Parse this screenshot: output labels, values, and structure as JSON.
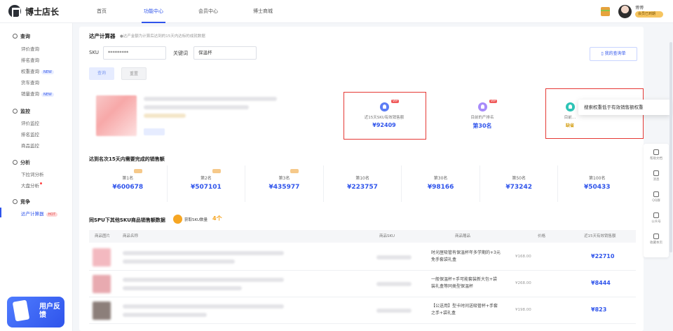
{
  "app": {
    "name": "博士店长"
  },
  "nav": [
    "首页",
    "功能中心",
    "会员中心",
    "博士商城"
  ],
  "user": {
    "name": "博博",
    "tag": "会员已到期"
  },
  "sidebar": {
    "groups": [
      {
        "title": "查询",
        "items": [
          {
            "label": "评价查询"
          },
          {
            "label": "排名查询"
          },
          {
            "label": "权重查询",
            "badge": "NEW"
          },
          {
            "label": "货车查询"
          },
          {
            "label": "销量查询",
            "badge": "NEW"
          }
        ]
      },
      {
        "title": "监控",
        "items": [
          {
            "label": "评价监控"
          },
          {
            "label": "排名监控"
          },
          {
            "label": "商品监控"
          }
        ]
      },
      {
        "title": "分析",
        "items": [
          {
            "label": "下拉词分析"
          },
          {
            "label": "大盘分析",
            "dot": true
          }
        ]
      },
      {
        "title": "竞争",
        "items": [
          {
            "label": "达产计算器",
            "badge": "HOT",
            "active": true
          }
        ]
      }
    ],
    "feedback": "用户反馈"
  },
  "page": {
    "title": "达产计算器",
    "tip": "●达产金额为计算后达到的15天内达标的成就数据"
  },
  "form": {
    "sku_label": "SKU",
    "sku_value": "*********",
    "keyword_label": "关键词",
    "keyword_value": "保温杯",
    "query": "查询",
    "reset": "重置",
    "my_data": "我的查询单"
  },
  "metrics": [
    {
      "label": "近15天SKU有效销售额",
      "value": "¥92409",
      "vip": "VIP"
    },
    {
      "label": "目前的产排名",
      "value": "第30名",
      "vip": "VIP"
    },
    {
      "label": "目前…",
      "value": "缺省"
    }
  ],
  "tooltip": "搜索权重低于有效销售额权重",
  "ranks_title": "达到名次15天内需要完成的销售额",
  "ranks": [
    {
      "label": "第1名",
      "value": "¥600678"
    },
    {
      "label": "第2名",
      "value": "¥507101"
    },
    {
      "label": "第3名",
      "value": "¥435977"
    },
    {
      "label": "第10名",
      "value": "¥223757"
    },
    {
      "label": "第30名",
      "value": "¥98166"
    },
    {
      "label": "第50名",
      "value": "¥73242"
    },
    {
      "label": "第100名",
      "value": "¥50433"
    }
  ],
  "table": {
    "title": "同SPU下其他SKU商品销售额数据",
    "coin_label": "获取SKU数量",
    "coin_num": "4个",
    "headers": [
      "商品图片",
      "商品名称",
      "商品SKU",
      "商品赠品",
      "价格",
      "近15天有效销售额"
    ],
    "rows": [
      {
        "gift": "时光匣吸管有保温杯年多学期的+3元免手套袋礼盒",
        "price": "¥168.00",
        "sales": "¥22710",
        "color": "#f3b9c0"
      },
      {
        "gift": "一般保温杯+手可能套装新大包+袋装礼盒等同类型保温杯",
        "price": "¥268.00",
        "sales": "¥8444",
        "color": "#e8aab0"
      },
      {
        "gift": "【公送用】型卡时间送吸管杯+手套之手+袋礼盒",
        "price": "¥198.00",
        "sales": "¥823",
        "color": "#8c7f7a"
      }
    ]
  },
  "right_tools": [
    "帮助文档",
    "消息",
    "QQ群",
    "公众号",
    "收藏本页"
  ]
}
